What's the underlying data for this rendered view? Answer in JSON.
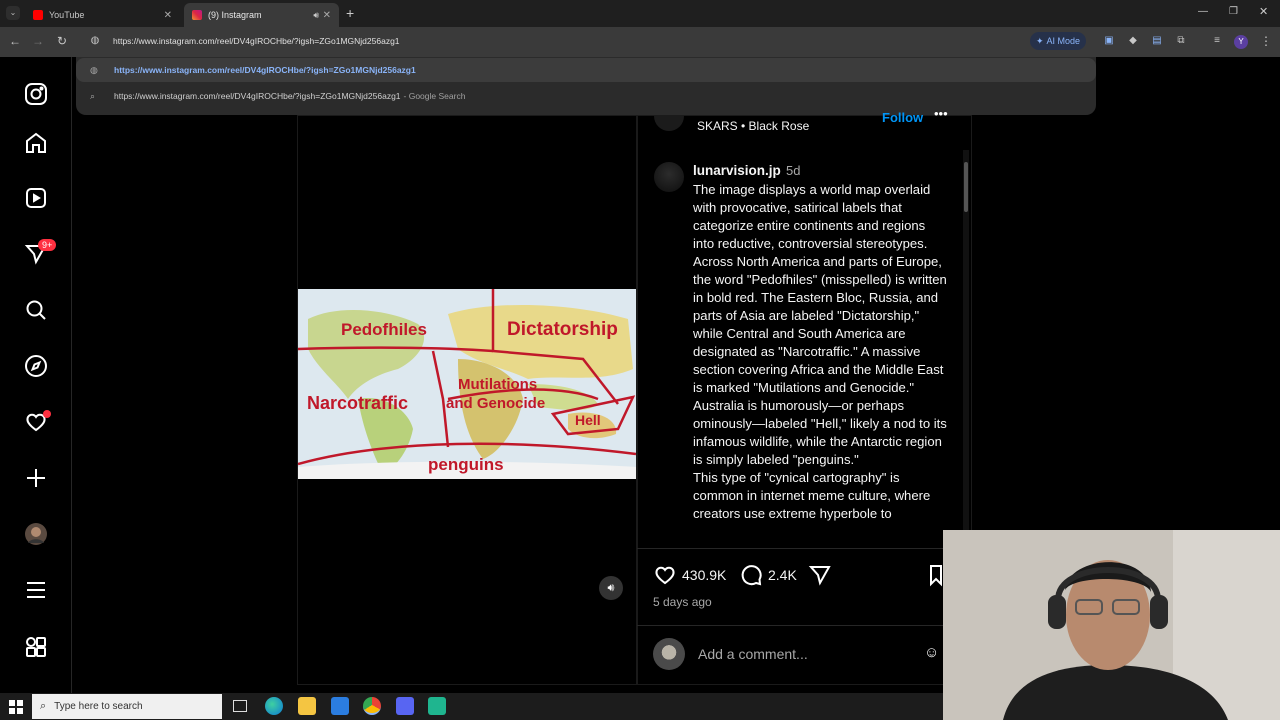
{
  "browser": {
    "tabs": [
      {
        "title": "YouTube",
        "active": false
      },
      {
        "title": "(9) Instagram",
        "active": true
      }
    ],
    "url": "https://www.instagram.com/reel/DV4gIROCHbe/?igsh=ZGo1MGNjd256azg1",
    "ai_mode_label": "AI Mode",
    "suggestions": [
      {
        "text": "https://www.instagram.com/reel/DV4gIROCHbe/?igsh=ZGo1MGNjd256azg1",
        "suffix": ""
      },
      {
        "text": "https://www.instagram.com/reel/DV4gIROCHbe/?igsh=ZGo1MGNjd256azg1",
        "suffix": "- Google Search"
      }
    ],
    "profile_initial": "Y"
  },
  "sidebar": {
    "notifications_badge": "9+",
    "items": [
      "instagram-logo",
      "home",
      "reels",
      "messages",
      "search",
      "explore",
      "notifications",
      "create",
      "profile",
      "more",
      "also-from-meta"
    ]
  },
  "reel": {
    "map_labels": {
      "pedofhiles": "Pedofhiles",
      "dictatorship": "Dictatorship",
      "narcotraffic": "Narcotraffic",
      "mutilations": "Mutilations\nand Genocide",
      "hell": "Hell",
      "penguins": "penguins"
    }
  },
  "post": {
    "song": "SKARS • Black Rose",
    "follow_label": "Follow",
    "username": "lunarvision.jp",
    "time": "5d",
    "caption": "The image displays a world map overlaid with provocative, satirical labels that categorize entire continents and regions into reductive, controversial stereotypes. Across North America and parts of Europe, the word \"Pedofhiles\" (misspelled) is written in bold red. The Eastern Bloc, Russia, and parts of Asia are labeled \"Dictatorship,\" while Central and South America are designated as \"Narcotraffic.\" A massive section covering Africa and the Middle East is marked \"Mutilations and Genocide.\" Australia is humorously—or perhaps ominously—labeled \"Hell,\" likely a nod to its infamous wildlife, while the Antarctic region is simply labeled \"penguins.\"\nThis type of \"cynical cartography\" is common in internet meme culture, where creators use extreme hyperbole to",
    "likes": "430.9K",
    "comments": "2.4K",
    "age": "5 days ago",
    "comment_placeholder": "Add a comment..."
  },
  "taskbar": {
    "search_placeholder": "Type here to search"
  },
  "colors": {
    "accent_blue": "#0095f6",
    "badge_red": "#ff3040",
    "map_red": "#c0182a"
  }
}
